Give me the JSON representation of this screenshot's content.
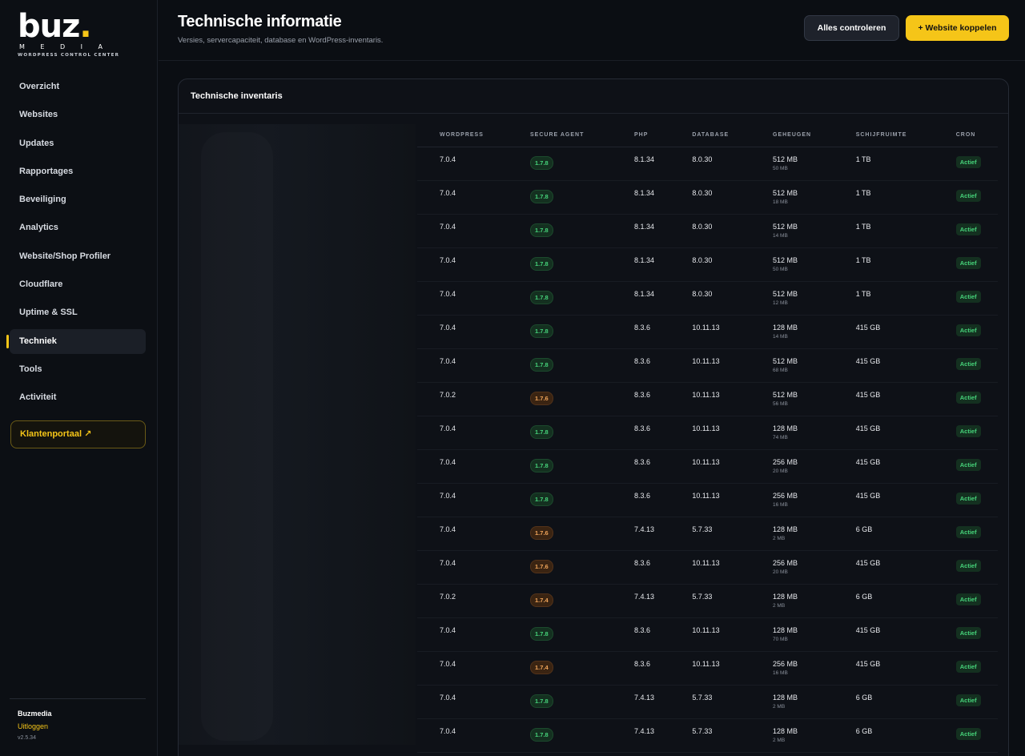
{
  "brand": {
    "logo_word": "buz",
    "logo_dot": ".",
    "logo_media": "MEDIA",
    "logo_sub": "WORDPRESS CONTROL CENTER",
    "accent_color": "#f5c518"
  },
  "sidebar": {
    "items": [
      {
        "label": "Overzicht",
        "active": false
      },
      {
        "label": "Websites",
        "active": false
      },
      {
        "label": "Updates",
        "active": false
      },
      {
        "label": "Rapportages",
        "active": false
      },
      {
        "label": "Beveiliging",
        "active": false
      },
      {
        "label": "Analytics",
        "active": false
      },
      {
        "label": "Website/Shop Profiler",
        "active": false
      },
      {
        "label": "Cloudflare",
        "active": false
      },
      {
        "label": "Uptime & SSL",
        "active": false
      },
      {
        "label": "Techniek",
        "active": true
      },
      {
        "label": "Tools",
        "active": false
      },
      {
        "label": "Activiteit",
        "active": false
      }
    ],
    "portal_label": "Klantenportaal ↗",
    "user_name": "Buzmedia",
    "logout_label": "Uitloggen",
    "version": "v2.5.34"
  },
  "header": {
    "title": "Technische informatie",
    "subtitle": "Versies, servercapaciteit, database en WordPress-inventaris.",
    "check_all_label": "Alles controleren",
    "add_site_label": "+ Website koppelen"
  },
  "card": {
    "title": "Technische inventaris",
    "columns": [
      "WORDPRESS",
      "SECURE AGENT",
      "PHP",
      "DATABASE",
      "GEHEUGEN",
      "SCHIJFRUIMTE",
      "CRON"
    ],
    "rows": [
      {
        "wp": "7.0.4",
        "agent": "1.7.8",
        "agent_status": "ok",
        "php": "8.1.34",
        "db": "8.0.30",
        "mem": "512 MB",
        "mem_used": "50 MB",
        "disk": "1 TB",
        "cron": "Actief"
      },
      {
        "wp": "7.0.4",
        "agent": "1.7.8",
        "agent_status": "ok",
        "php": "8.1.34",
        "db": "8.0.30",
        "mem": "512 MB",
        "mem_used": "18 MB",
        "disk": "1 TB",
        "cron": "Actief"
      },
      {
        "wp": "7.0.4",
        "agent": "1.7.8",
        "agent_status": "ok",
        "php": "8.1.34",
        "db": "8.0.30",
        "mem": "512 MB",
        "mem_used": "14 MB",
        "disk": "1 TB",
        "cron": "Actief"
      },
      {
        "wp": "7.0.4",
        "agent": "1.7.8",
        "agent_status": "ok",
        "php": "8.1.34",
        "db": "8.0.30",
        "mem": "512 MB",
        "mem_used": "50 MB",
        "disk": "1 TB",
        "cron": "Actief"
      },
      {
        "wp": "7.0.4",
        "agent": "1.7.8",
        "agent_status": "ok",
        "php": "8.1.34",
        "db": "8.0.30",
        "mem": "512 MB",
        "mem_used": "12 MB",
        "disk": "1 TB",
        "cron": "Actief"
      },
      {
        "wp": "7.0.4",
        "agent": "1.7.8",
        "agent_status": "ok",
        "php": "8.3.6",
        "db": "10.11.13",
        "mem": "128 MB",
        "mem_used": "14 MB",
        "disk": "415 GB",
        "cron": "Actief"
      },
      {
        "wp": "7.0.4",
        "agent": "1.7.8",
        "agent_status": "ok",
        "php": "8.3.6",
        "db": "10.11.13",
        "mem": "512 MB",
        "mem_used": "68 MB",
        "disk": "415 GB",
        "cron": "Actief"
      },
      {
        "wp": "7.0.2",
        "agent": "1.7.6",
        "agent_status": "old",
        "php": "8.3.6",
        "db": "10.11.13",
        "mem": "512 MB",
        "mem_used": "56 MB",
        "disk": "415 GB",
        "cron": "Actief"
      },
      {
        "wp": "7.0.4",
        "agent": "1.7.8",
        "agent_status": "ok",
        "php": "8.3.6",
        "db": "10.11.13",
        "mem": "128 MB",
        "mem_used": "74 MB",
        "disk": "415 GB",
        "cron": "Actief"
      },
      {
        "wp": "7.0.4",
        "agent": "1.7.8",
        "agent_status": "ok",
        "php": "8.3.6",
        "db": "10.11.13",
        "mem": "256 MB",
        "mem_used": "20 MB",
        "disk": "415 GB",
        "cron": "Actief"
      },
      {
        "wp": "7.0.4",
        "agent": "1.7.8",
        "agent_status": "ok",
        "php": "8.3.6",
        "db": "10.11.13",
        "mem": "256 MB",
        "mem_used": "16 MB",
        "disk": "415 GB",
        "cron": "Actief"
      },
      {
        "wp": "7.0.4",
        "agent": "1.7.6",
        "agent_status": "old",
        "php": "7.4.13",
        "db": "5.7.33",
        "mem": "128 MB",
        "mem_used": "2 MB",
        "disk": "6 GB",
        "cron": "Actief"
      },
      {
        "wp": "7.0.4",
        "agent": "1.7.6",
        "agent_status": "old",
        "php": "8.3.6",
        "db": "10.11.13",
        "mem": "256 MB",
        "mem_used": "20 MB",
        "disk": "415 GB",
        "cron": "Actief"
      },
      {
        "wp": "7.0.2",
        "agent": "1.7.4",
        "agent_status": "old",
        "php": "7.4.13",
        "db": "5.7.33",
        "mem": "128 MB",
        "mem_used": "2 MB",
        "disk": "6 GB",
        "cron": "Actief"
      },
      {
        "wp": "7.0.4",
        "agent": "1.7.8",
        "agent_status": "ok",
        "php": "8.3.6",
        "db": "10.11.13",
        "mem": "128 MB",
        "mem_used": "70 MB",
        "disk": "415 GB",
        "cron": "Actief"
      },
      {
        "wp": "7.0.4",
        "agent": "1.7.4",
        "agent_status": "old",
        "php": "8.3.6",
        "db": "10.11.13",
        "mem": "256 MB",
        "mem_used": "16 MB",
        "disk": "415 GB",
        "cron": "Actief"
      },
      {
        "wp": "7.0.4",
        "agent": "1.7.8",
        "agent_status": "ok",
        "php": "7.4.13",
        "db": "5.7.33",
        "mem": "128 MB",
        "mem_used": "2 MB",
        "disk": "6 GB",
        "cron": "Actief"
      },
      {
        "wp": "7.0.4",
        "agent": "1.7.8",
        "agent_status": "ok",
        "php": "7.4.13",
        "db": "5.7.33",
        "mem": "128 MB",
        "mem_used": "2 MB",
        "disk": "6 GB",
        "cron": "Actief"
      }
    ]
  }
}
